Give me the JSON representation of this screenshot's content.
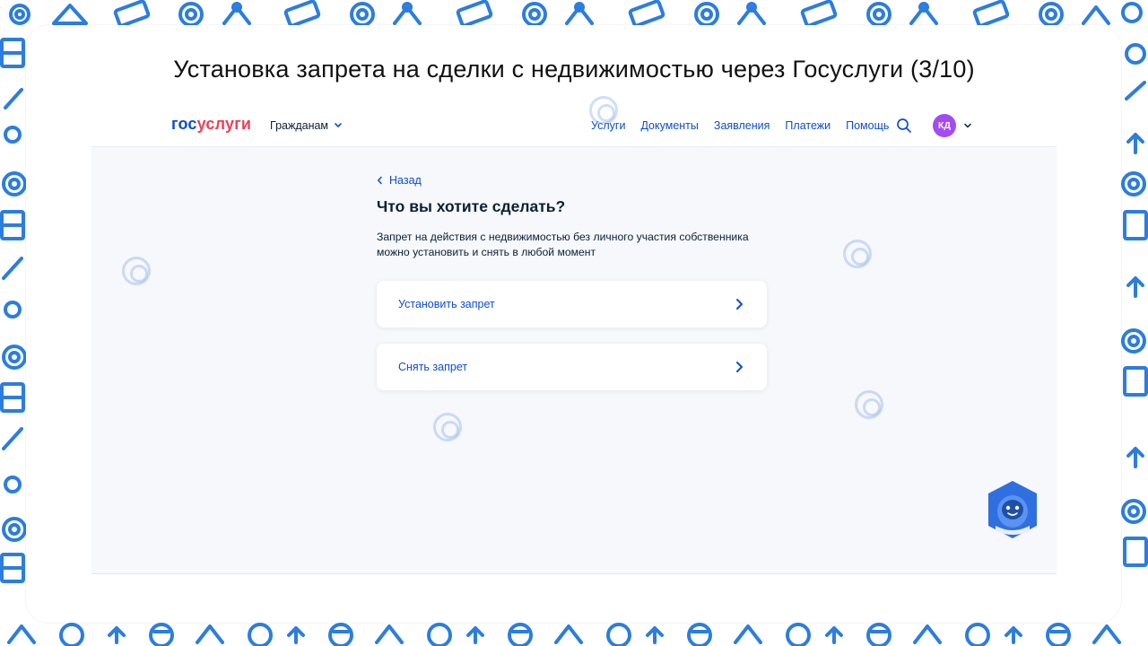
{
  "slide": {
    "title": "Установка запрета на сделки с недвижимостью через Госуслуги (3/10)"
  },
  "header": {
    "logo_part1": "гос",
    "logo_part2": "услуги",
    "audience_label": "Гражданам",
    "nav": [
      "Услуги",
      "Документы",
      "Заявления",
      "Платежи",
      "Помощь"
    ],
    "avatar_initials": "КД"
  },
  "main": {
    "back_label": "Назад",
    "heading": "Что вы хотите сделать?",
    "description": "Запрет на действия с недвижимостью без личного участия собственника можно установить и снять в любой момент",
    "options": [
      {
        "label": "Установить запрет"
      },
      {
        "label": "Снять запрет"
      }
    ]
  },
  "colors": {
    "brand_blue": "#0d4cd3",
    "brand_red": "#ee3f58",
    "avatar_purple": "#a34bf3",
    "pattern_blue": "#2b7de0",
    "page_bg": "#f6f8fb"
  },
  "icons": {
    "search": "search-icon",
    "chevron_down": "chevron-down-icon",
    "chevron_left": "chevron-left-icon",
    "chevron_right": "chevron-right-icon",
    "assistant": "robot-assistant-icon"
  }
}
